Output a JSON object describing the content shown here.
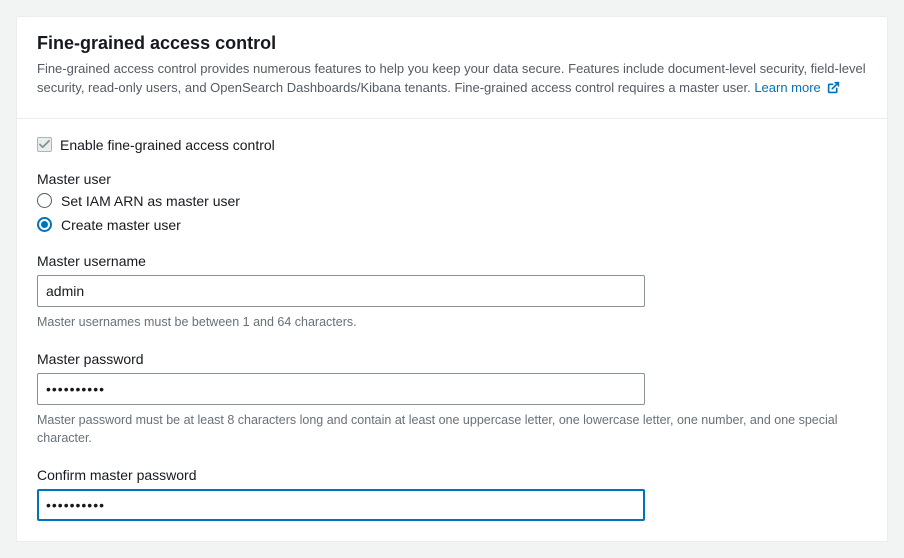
{
  "header": {
    "title": "Fine-grained access control",
    "description": "Fine-grained access control provides numerous features to help you keep your data secure. Features include document-level security, field-level security, read-only users, and OpenSearch Dashboards/Kibana tenants. Fine-grained access control requires a master user.",
    "learn_more": "Learn more"
  },
  "enable_checkbox": {
    "label": "Enable fine-grained access control",
    "checked": true,
    "disabled": true
  },
  "master_user": {
    "section_label": "Master user",
    "options": {
      "iam_arn": "Set IAM ARN as master user",
      "create": "Create master user"
    },
    "selected": "create"
  },
  "username_field": {
    "label": "Master username",
    "value": "admin",
    "hint": "Master usernames must be between 1 and 64 characters."
  },
  "password_field": {
    "label": "Master password",
    "value": "••••••••••",
    "hint": "Master password must be at least 8 characters long and contain at least one uppercase letter, one lowercase letter, one number, and one special character."
  },
  "confirm_password_field": {
    "label": "Confirm master password",
    "value": "••••••••••"
  }
}
